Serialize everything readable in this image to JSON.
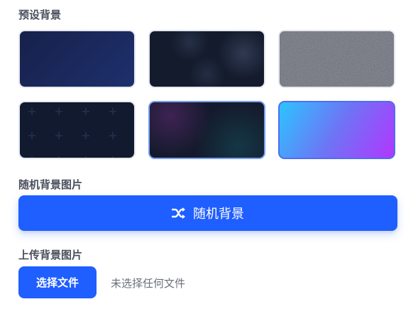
{
  "presets": {
    "label": "预设背景",
    "tiles": [
      {
        "name": "深蓝渐变",
        "colors": [
          "#16214a",
          "#1e2f6d"
        ]
      },
      {
        "name": "光斑",
        "colors": [
          "#141b2d",
          "#46526e"
        ]
      },
      {
        "name": "噪点",
        "colors": [
          "#5e6270"
        ]
      },
      {
        "name": "十字网格",
        "colors": [
          "#111a2e",
          "#1e2a4a"
        ]
      },
      {
        "name": "极光",
        "colors": [
          "#141a2c",
          "#5a286e",
          "#14505a"
        ],
        "selected": true
      },
      {
        "name": "霓虹渐变",
        "colors": [
          "#2cc4ff",
          "#6e74f5",
          "#b137ff"
        ]
      }
    ]
  },
  "random": {
    "label": "随机背景图片",
    "button_label": "随机背景",
    "icon": "shuffle-icon"
  },
  "upload": {
    "label": "上传背景图片",
    "button_label": "选择文件",
    "status": "未选择任何文件"
  },
  "colors": {
    "accent": "#1f5eff",
    "selected_border": "#7aa0f2"
  }
}
